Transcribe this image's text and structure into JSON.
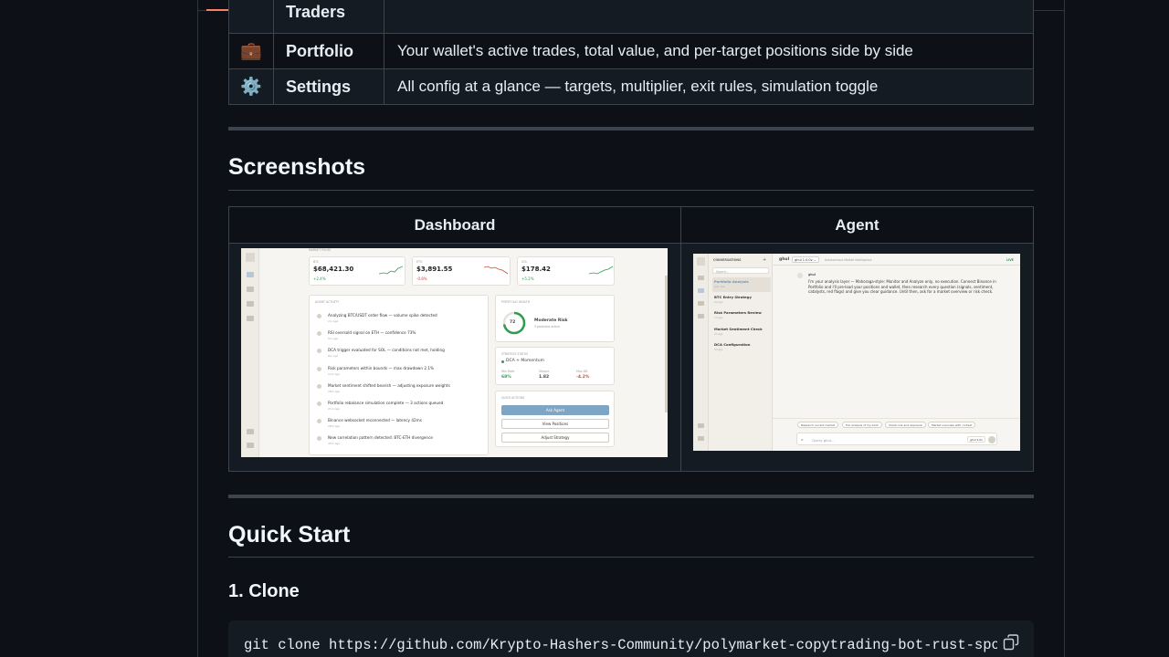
{
  "features": [
    {
      "icon": "chart-icon",
      "glyph": "",
      "name": "Traders",
      "desc": ""
    },
    {
      "icon": "briefcase-icon",
      "glyph": "💼",
      "name": "Portfolio",
      "desc": "Your wallet's active trades, total value, and per-target positions side by side"
    },
    {
      "icon": "gear-icon",
      "glyph": "⚙️",
      "name": "Settings",
      "desc": "All config at a glance — targets, multiplier, exit rules, simulation toggle"
    }
  ],
  "screenshots": {
    "heading": "Screenshots",
    "col_dashboard": "Dashboard",
    "col_agent": "Agent"
  },
  "dashboard_mock": {
    "market_pulse": "MARKET PULSE",
    "tickers": [
      {
        "sym": "BTC",
        "price": "$68,421.30",
        "chg": "+2.4%",
        "dir": "up"
      },
      {
        "sym": "ETH",
        "price": "$3,891.55",
        "chg": "-0.8%",
        "dir": "down"
      },
      {
        "sym": "SOL",
        "price": "$178.42",
        "chg": "+5.2%",
        "dir": "up"
      }
    ],
    "activity_title": "AGENT ACTIVITY",
    "activity": [
      {
        "text": "Analyzing BTC/USDT order flow — volume spike detected",
        "ago": "2m ago"
      },
      {
        "text": "RSI oversold signal on ETH — confidence 73%",
        "ago": "5m ago"
      },
      {
        "text": "DCA trigger evaluated for SOL — conditions not met, holding",
        "ago": "8m ago"
      },
      {
        "text": "Risk parameters within bounds — max drawdown 2.1%",
        "ago": "12m ago"
      },
      {
        "text": "Market sentiment shifted bearish — adjusting exposure weights",
        "ago": "18m ago"
      },
      {
        "text": "Portfolio rebalance simulation complete — 3 actions queued",
        "ago": "21m ago"
      },
      {
        "text": "Binance websocket reconnected — latency 42ms",
        "ago": "28m ago"
      },
      {
        "text": "New correlation pattern detected: BTC-ETH divergence",
        "ago": "45m ago"
      }
    ],
    "health_title": "PORTFOLIO HEALTH",
    "health_score": "72",
    "health_label": "Moderate Risk",
    "health_sub": "3 positions active",
    "strategy_title": "STRATEGY STATUS",
    "strategy_name": "DCA + Momentum",
    "stats": [
      {
        "label": "Win Rate",
        "value": "68%"
      },
      {
        "label": "Sharpe",
        "value": "1.82"
      },
      {
        "label": "Max DD",
        "value": "-4.2%"
      }
    ],
    "quick_title": "QUICK ACTIONS",
    "quick": [
      "Ask Agent",
      "View Positions",
      "Adjust Strategy"
    ]
  },
  "agent_mock": {
    "conv_title": "CONVERSATIONS",
    "search": "Search...",
    "conversations": [
      {
        "title": "Portfolio Analysis",
        "ago": "Just now"
      },
      {
        "title": "BTC Entry Strategy",
        "ago": "2h ago"
      },
      {
        "title": "Risk Parameters Review",
        "ago": "1d ago"
      },
      {
        "title": "Market Sentiment Check",
        "ago": "2d ago"
      },
      {
        "title": "DCA Configuration",
        "ago": "3d ago"
      }
    ],
    "agent_name": "ghul",
    "model": "ghul 1.0.0v",
    "subtitle": "Autonomous Market Intelligence",
    "status": "LIVE",
    "message_author": "ghul",
    "message": "I'm your analysis layer — Mahoraga-style: Monitor and Analyze only, no execution. Connect Binance in Portfolio and I'll pre-load your positions and wallet, then research every question (signals, sentiment, catalysts, red flags) and give you clear guidance. Until then, ask for a market overview or risk check.",
    "chips": [
      "Research current market",
      "Full analysis of my book",
      "Check risk and exposure",
      "Market overview with context"
    ],
    "input_placeholder": "Query ghul...",
    "input_model": "ghul 1.0v"
  },
  "quick_start": {
    "heading": "Quick Start",
    "step1": "1. Clone",
    "command": "git clone https://github.com/Krypto-Hashers-Community/polymarket-copytrading-bot-rust-sport-crypto.git"
  }
}
